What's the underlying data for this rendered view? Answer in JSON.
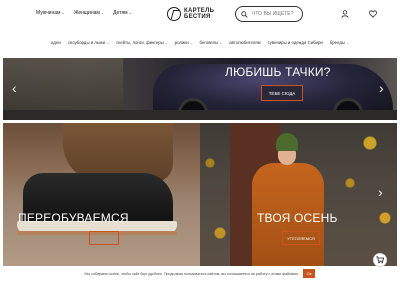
{
  "header": {
    "nav": [
      {
        "label": "Мужчинам"
      },
      {
        "label": "Женщинам"
      },
      {
        "label": "Детям"
      }
    ],
    "logo_line1": "КАРТЕЛЬ",
    "logo_line2": "БЕСТИЯ",
    "search_placeholder": "ЧТО ВЫ ИЩЕТЕ?"
  },
  "categories": [
    {
      "label": "идеи",
      "has_dropdown": false
    },
    {
      "label": "сноуборды и лыжи",
      "has_dropdown": true
    },
    {
      "label": "скейты, лонги, фингеры",
      "has_dropdown": true
    },
    {
      "label": "ролики",
      "has_dropdown": true
    },
    {
      "label": "беговелы",
      "has_dropdown": true
    },
    {
      "label": "автолюбителям",
      "has_dropdown": false
    },
    {
      "label": "сувениры и одежда Сибири",
      "has_dropdown": false
    },
    {
      "label": "бренды",
      "has_dropdown": true
    }
  ],
  "hero": {
    "title": "ЛЮБИШЬ ТАЧКИ?",
    "button_label": "ТЕБЕ СЮДА"
  },
  "tiles": [
    {
      "title": "ПЕРЕОБУВАЕМСЯ",
      "button_label": ""
    },
    {
      "title": "ТВОЯ ОСЕНЬ",
      "button_label": "УТЕПЛЯЕМСЯ"
    }
  ],
  "cookie": {
    "text": "Мы собираем cookie, чтобы сайт был удобнее. Продолжая пользоваться сайтом, вы соглашаетесь на работу с этими файлами.",
    "button_label": "Ок"
  },
  "colors": {
    "accent": "#c8551e",
    "text": "#222222"
  }
}
